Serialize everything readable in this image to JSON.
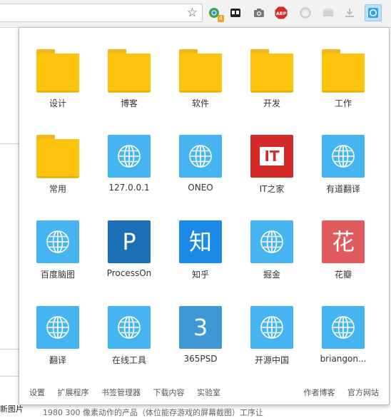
{
  "extensions": [
    {
      "name": "chrome-ext-green-icon",
      "badge": "4"
    },
    {
      "name": "dual-square-icon"
    },
    {
      "name": "camera-icon"
    },
    {
      "name": "adblock-plus-icon",
      "label": "ABP"
    },
    {
      "name": "swirl-icon"
    },
    {
      "name": "grey-box-icon"
    },
    {
      "name": "download-icon"
    },
    {
      "name": "active-launcher-icon"
    }
  ],
  "items": [
    {
      "label": "设计",
      "type": "folder"
    },
    {
      "label": "博客",
      "type": "folder"
    },
    {
      "label": "软件",
      "type": "folder"
    },
    {
      "label": "开发",
      "type": "folder"
    },
    {
      "label": "工作",
      "type": "folder"
    },
    {
      "label": "常用",
      "type": "folder"
    },
    {
      "label": "127.0.0.1",
      "type": "globe"
    },
    {
      "label": "ONEO",
      "type": "globe"
    },
    {
      "label": "IT之家",
      "type": "it",
      "tile_text": "IT",
      "color": "#d42a2a"
    },
    {
      "label": "有道翻译",
      "type": "globe"
    },
    {
      "label": "百度脑图",
      "type": "globe"
    },
    {
      "label": "ProcessOn",
      "type": "char",
      "tile_text": "P",
      "color": "#1b6fb5"
    },
    {
      "label": "知乎",
      "type": "char",
      "tile_text": "知",
      "color": "#1a8ae6"
    },
    {
      "label": "掘金",
      "type": "globe"
    },
    {
      "label": "花瓣",
      "type": "char",
      "tile_text": "花",
      "color": "#e05a5e"
    },
    {
      "label": "翻译",
      "type": "globe"
    },
    {
      "label": "在线工具",
      "type": "globe"
    },
    {
      "label": "365PSD",
      "type": "char",
      "tile_text": "3",
      "color": "#3e98d6"
    },
    {
      "label": "开源中国",
      "type": "globe"
    },
    {
      "label": "briangon...",
      "type": "globe"
    }
  ],
  "footer": {
    "left": [
      "设置",
      "扩展程序",
      "书签管理器",
      "下载内容",
      "实验室"
    ],
    "right": [
      "作者博客",
      "官方网站"
    ]
  },
  "background": {
    "left_text": "新图片",
    "bottom_text": "1980 300 像素动作的产品（体位能存游戏的屏幕截图）工序让"
  },
  "colors": {
    "folder": "#ffc40e",
    "globe_tile": "#45b4f0",
    "active_extension": "#bfe0f5"
  }
}
